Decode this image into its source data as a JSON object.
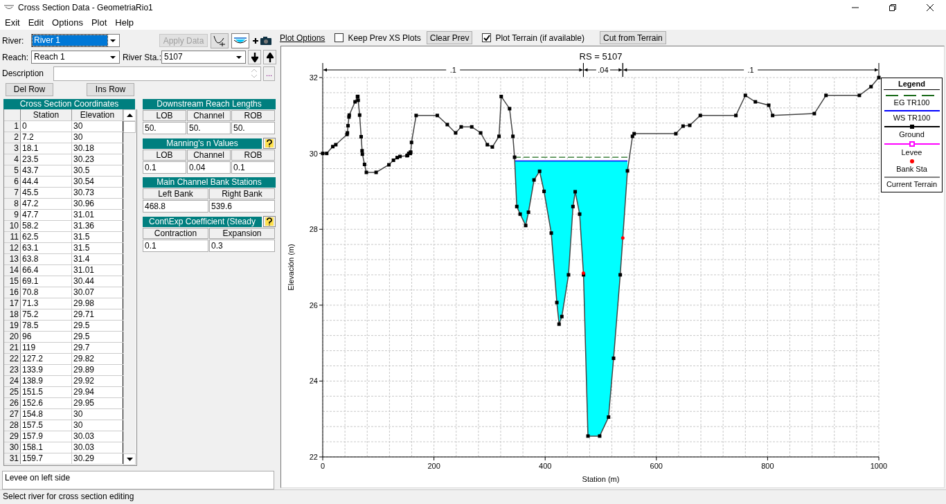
{
  "window": {
    "title": "Cross Section Data - GeometriaRio1"
  },
  "menu": [
    "Exit",
    "Edit",
    "Options",
    "Plot",
    "Help"
  ],
  "river": {
    "label": "River:",
    "value": "River 1",
    "selected": true
  },
  "apply_button": {
    "label": "Apply Data",
    "disabled": true
  },
  "reach": {
    "label": "Reach:",
    "value": "Reach 1"
  },
  "river_sta": {
    "label": "River Sta.:",
    "value": "5107"
  },
  "description": {
    "label": "Description",
    "more": "..."
  },
  "row_buttons": [
    "Del Row",
    "Ins Row"
  ],
  "coordinates": {
    "title": "Cross Section Coordinates",
    "columns": [
      "Station",
      "Elevation"
    ],
    "rows": [
      {
        "index": "1",
        "station": "0",
        "elevation": "30"
      },
      {
        "index": "2",
        "station": "7.2",
        "elevation": "30"
      },
      {
        "index": "3",
        "station": "18.1",
        "elevation": "30.18"
      },
      {
        "index": "4",
        "station": "23.5",
        "elevation": "30.23"
      },
      {
        "index": "5",
        "station": "43.7",
        "elevation": "30.5"
      },
      {
        "index": "6",
        "station": "44.4",
        "elevation": "30.54"
      },
      {
        "index": "7",
        "station": "45.5",
        "elevation": "30.73"
      },
      {
        "index": "8",
        "station": "47.2",
        "elevation": "30.96"
      },
      {
        "index": "9",
        "station": "47.7",
        "elevation": "31.01"
      },
      {
        "index": "10",
        "station": "58.2",
        "elevation": "31.36"
      },
      {
        "index": "11",
        "station": "62.5",
        "elevation": "31.5"
      },
      {
        "index": "12",
        "station": "63.1",
        "elevation": "31.5"
      },
      {
        "index": "13",
        "station": "63.8",
        "elevation": "31.4"
      },
      {
        "index": "14",
        "station": "66.4",
        "elevation": "31.01"
      },
      {
        "index": "15",
        "station": "69.1",
        "elevation": "30.44"
      },
      {
        "index": "16",
        "station": "70.8",
        "elevation": "30.07"
      },
      {
        "index": "17",
        "station": "71.3",
        "elevation": "29.98"
      },
      {
        "index": "18",
        "station": "75.2",
        "elevation": "29.71"
      },
      {
        "index": "19",
        "station": "78.5",
        "elevation": "29.5"
      },
      {
        "index": "20",
        "station": "96",
        "elevation": "29.5"
      },
      {
        "index": "21",
        "station": "119",
        "elevation": "29.7"
      },
      {
        "index": "22",
        "station": "127.2",
        "elevation": "29.82"
      },
      {
        "index": "23",
        "station": "133.9",
        "elevation": "29.89"
      },
      {
        "index": "24",
        "station": "138.9",
        "elevation": "29.92"
      },
      {
        "index": "25",
        "station": "151.5",
        "elevation": "29.94"
      },
      {
        "index": "26",
        "station": "152.6",
        "elevation": "29.95"
      },
      {
        "index": "27",
        "station": "154.8",
        "elevation": "30"
      },
      {
        "index": "28",
        "station": "157.5",
        "elevation": "30"
      },
      {
        "index": "29",
        "station": "157.9",
        "elevation": "30.03"
      },
      {
        "index": "30",
        "station": "158.1",
        "elevation": "30.03"
      },
      {
        "index": "31",
        "station": "159.7",
        "elevation": "30.29"
      }
    ]
  },
  "reach_lengths": {
    "title": "Downstream Reach Lengths",
    "columns": [
      "LOB",
      "Channel",
      "ROB"
    ],
    "values": [
      "50.",
      "50.",
      "50."
    ]
  },
  "mannings": {
    "title": "Manning's n Values",
    "columns": [
      "LOB",
      "Channel",
      "ROB"
    ],
    "values": [
      "0.1",
      "0.04",
      "0.1"
    ]
  },
  "bank_stations": {
    "title": "Main Channel Bank Stations",
    "columns": [
      "Left Bank",
      "Right Bank"
    ],
    "values": [
      "468.8",
      "539.6"
    ]
  },
  "coefficients": {
    "title": "Cont\\Exp Coefficient (Steady",
    "columns": [
      "Contraction",
      "Expansion"
    ],
    "values": [
      "0.1",
      "0.3"
    ]
  },
  "notes": "Levee on left side",
  "plot_toolbar": {
    "plot_options": "Plot Options",
    "keep_prev": {
      "label": "Keep Prev XS Plots",
      "checked": false
    },
    "clear_prev": "Clear Prev",
    "plot_terrain": {
      "label": "Plot Terrain (if available)",
      "checked": true
    },
    "cut_terrain": "Cut from Terrain"
  },
  "plot": {
    "n_labels": [
      ".1",
      ".04",
      ".1"
    ],
    "chart_data": {
      "type": "line",
      "grid": true,
      "title": "RS = 5107",
      "xlabel": "Station (m)",
      "ylabel": "Elevación (m)",
      "xlim": [
        0,
        1000
      ],
      "ylim": [
        22,
        32
      ],
      "xticks": [
        0,
        200,
        400,
        600,
        800,
        1000
      ],
      "yticks": [
        22,
        24,
        26,
        28,
        30,
        32
      ],
      "x": [
        0,
        7.2,
        18.1,
        23.5,
        43.7,
        44.4,
        45.5,
        47.2,
        47.7,
        58.2,
        62.5,
        63.1,
        63.8,
        66.4,
        69.1,
        70.8,
        71.3,
        75.2,
        78.5,
        96,
        119,
        127.2,
        133.9,
        138.9,
        151.5,
        152.6,
        154.8,
        157.5,
        157.9,
        158.1,
        159.7,
        168,
        206,
        224,
        239,
        249,
        268,
        284,
        296,
        305,
        317,
        321,
        336,
        342,
        345,
        349,
        355,
        365,
        370,
        380,
        390,
        398,
        411,
        421,
        425,
        430,
        442,
        450,
        454,
        462,
        469,
        477,
        498,
        514,
        523,
        535,
        548,
        557,
        560,
        635,
        648,
        660,
        679,
        743,
        760,
        778,
        802,
        809,
        884,
        905,
        965,
        986,
        1000
      ],
      "series": [
        {
          "name": "EG TR100",
          "color": "#1a6b1a",
          "line_style": "dashed",
          "values": [
            null,
            null,
            null,
            null,
            null,
            null,
            null,
            null,
            null,
            null,
            null,
            null,
            null,
            null,
            null,
            null,
            null,
            null,
            null,
            null,
            null,
            null,
            null,
            null,
            null,
            null,
            null,
            null,
            null,
            null,
            null,
            null,
            null,
            null,
            null,
            null,
            null,
            null,
            null,
            null,
            null,
            null,
            null,
            null,
            29.9,
            29.9,
            29.9,
            29.9,
            29.9,
            29.9,
            29.9,
            29.9,
            29.9,
            29.9,
            29.9,
            29.9,
            29.9,
            29.9,
            29.9,
            29.9,
            29.9,
            29.9,
            29.9,
            29.9,
            29.9,
            29.9,
            29.9,
            null,
            null,
            null,
            null,
            null,
            null,
            null,
            null,
            null,
            null,
            null,
            null,
            null,
            null,
            null,
            null
          ]
        },
        {
          "name": "WS TR100",
          "color": "#0000ff",
          "line_style": "solid",
          "values": [
            null,
            null,
            null,
            null,
            null,
            null,
            null,
            null,
            null,
            null,
            null,
            null,
            null,
            null,
            null,
            null,
            null,
            null,
            null,
            null,
            null,
            null,
            null,
            null,
            null,
            null,
            null,
            null,
            null,
            null,
            null,
            null,
            null,
            null,
            null,
            null,
            null,
            null,
            null,
            null,
            null,
            null,
            null,
            null,
            29.8,
            29.8,
            29.8,
            29.8,
            29.8,
            29.8,
            29.8,
            29.8,
            29.8,
            29.8,
            29.8,
            29.8,
            29.8,
            29.8,
            29.8,
            29.8,
            29.8,
            29.8,
            29.8,
            29.8,
            29.8,
            29.8,
            29.8,
            null,
            null,
            null,
            null,
            null,
            null,
            null,
            null,
            null,
            null,
            null,
            null,
            null,
            null,
            null,
            null
          ]
        },
        {
          "name": "Ground",
          "color": "#000000",
          "line_style": "solid",
          "marker": "square",
          "values": [
            30,
            30,
            30.18,
            30.23,
            30.5,
            30.54,
            30.73,
            30.96,
            31.01,
            31.36,
            31.5,
            31.5,
            31.4,
            31.01,
            30.44,
            30.07,
            29.98,
            29.71,
            29.5,
            29.5,
            29.7,
            29.82,
            29.89,
            29.92,
            29.94,
            29.95,
            30,
            30,
            30.03,
            30.03,
            30.29,
            31.0,
            31.0,
            30.76,
            30.54,
            30.7,
            30.7,
            30.54,
            30.23,
            30.17,
            30.45,
            31.5,
            31.18,
            30.45,
            29.9,
            28.6,
            28.4,
            28.1,
            28.45,
            29.3,
            29.53,
            29.0,
            27.9,
            26.07,
            25.5,
            25.7,
            26.8,
            28.6,
            28.99,
            28.4,
            26.8,
            22.55,
            22.55,
            23.05,
            24.6,
            26.8,
            29.54,
            30.45,
            30.52,
            30.52,
            30.72,
            30.74,
            31.0,
            31.0,
            31.53,
            31.36,
            31.27,
            31.0,
            31.05,
            31.53,
            31.53,
            31.76,
            32.0
          ]
        }
      ]
    },
    "legend": {
      "title": "Legend",
      "items": [
        {
          "label": "Levee",
          "kind": "square-line",
          "color": "#ff00ff"
        },
        {
          "label": "Bank Sta",
          "kind": "dot",
          "color": "#ff0000"
        },
        {
          "label": "Current Terrain",
          "kind": "line",
          "color": "#808080"
        }
      ]
    }
  },
  "status_bar": "Select river for cross section editing"
}
